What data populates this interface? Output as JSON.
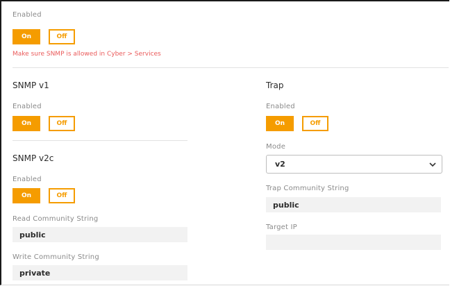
{
  "top": {
    "enabled_label": "Enabled",
    "on_label": "On",
    "off_label": "Off",
    "warning": "Make sure SNMP is allowed in Cyber > Services"
  },
  "snmp_v1": {
    "title": "SNMP v1",
    "enabled_label": "Enabled",
    "on_label": "On",
    "off_label": "Off"
  },
  "snmp_v2c": {
    "title": "SNMP v2c",
    "enabled_label": "Enabled",
    "on_label": "On",
    "off_label": "Off",
    "read_label": "Read Community String",
    "read_value": "public",
    "write_label": "Write Community String",
    "write_value": "private"
  },
  "trap": {
    "title": "Trap",
    "enabled_label": "Enabled",
    "on_label": "On",
    "off_label": "Off",
    "mode_label": "Mode",
    "mode_value": "v2",
    "community_label": "Trap Community String",
    "community_value": "public",
    "target_label": "Target IP",
    "target_value": ""
  },
  "colors": {
    "accent": "#f59c00",
    "warning": "#ea5a5a"
  },
  "icons": {
    "dropdown": "chevron-down-icon"
  }
}
